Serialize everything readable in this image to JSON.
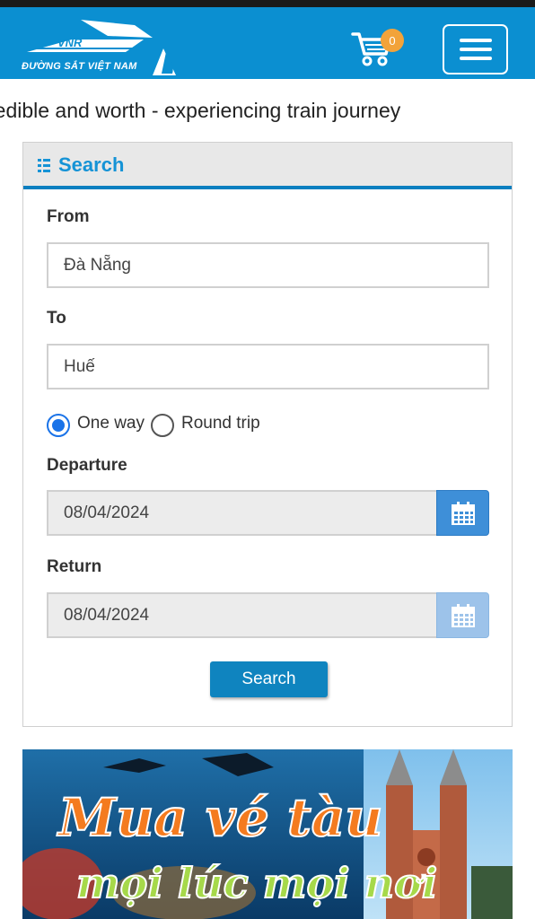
{
  "header": {
    "logo_letters": "VNR",
    "logo_text": "ĐƯỜNG SẮT VIỆT NAM",
    "cart_count": "0",
    "brand_color": "#0b8fd1",
    "cart_icon": "shopping-cart-icon",
    "menu_icon": "hamburger-menu-icon"
  },
  "marquee": {
    "text": "redible and worth - experiencing train journey"
  },
  "search_panel": {
    "title": "Search",
    "title_icon": "list-icon",
    "from_label": "From",
    "from_value": "Đà Nẵng",
    "to_label": "To",
    "to_value": "Huế",
    "trip_options": [
      {
        "label": "One way",
        "checked": true
      },
      {
        "label": "Round trip",
        "checked": false
      }
    ],
    "departure_label": "Departure",
    "departure_value": "08/04/2024",
    "return_label": "Return",
    "return_value": "08/04/2024",
    "calendar_icon": "calendar-icon",
    "search_button": "Search",
    "accent_color": "#1593d6"
  },
  "banner": {
    "headline": "Mua vé tàu",
    "subline": "mọi lúc mọi nơi"
  }
}
